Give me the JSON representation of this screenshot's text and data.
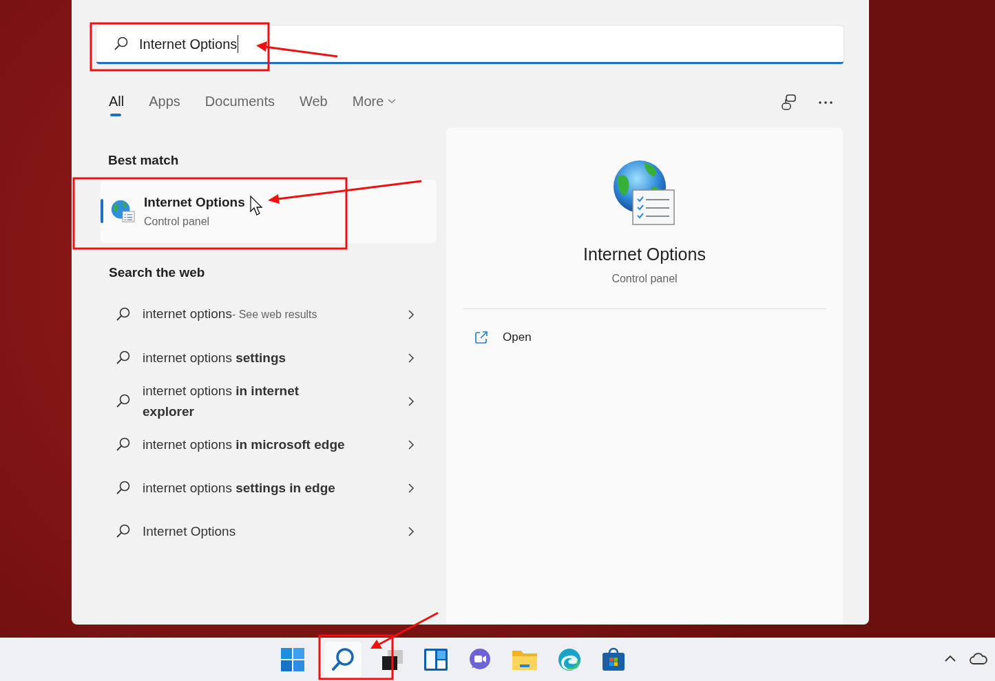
{
  "search": {
    "value": "Internet Options"
  },
  "tabs": [
    {
      "label": "All",
      "selected": true,
      "dropdown": false
    },
    {
      "label": "Apps",
      "selected": false,
      "dropdown": false
    },
    {
      "label": "Documents",
      "selected": false,
      "dropdown": false
    },
    {
      "label": "Web",
      "selected": false,
      "dropdown": false
    },
    {
      "label": "More",
      "selected": false,
      "dropdown": true
    }
  ],
  "best_match": {
    "heading": "Best match",
    "title": "Internet Options",
    "subtitle": "Control panel",
    "selected": true
  },
  "web": {
    "heading": "Search the web",
    "results": [
      {
        "text": "internet options",
        "hint": "- See web results"
      },
      {
        "text": "internet options **settings**"
      },
      {
        "text": "internet options **in internet explorer**"
      },
      {
        "text": "internet options **in microsoft edge**"
      },
      {
        "text": "internet options **settings in edge**"
      },
      {
        "text": "Internet Options"
      }
    ]
  },
  "preview": {
    "title": "Internet Options",
    "subtitle": "Control panel",
    "actions": [
      {
        "label": "Open"
      }
    ]
  }
}
